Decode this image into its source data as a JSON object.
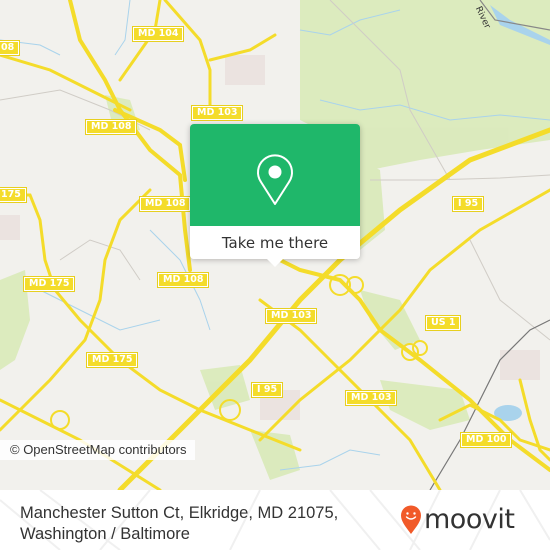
{
  "map": {
    "road_labels": [
      {
        "id": "md104",
        "text": "MD 104"
      },
      {
        "id": "md108-left-edge",
        "text": "08"
      },
      {
        "id": "md103-top",
        "text": "MD 103"
      },
      {
        "id": "md108-a",
        "text": "MD 108"
      },
      {
        "id": "md175-left-edge",
        "text": "175"
      },
      {
        "id": "md108-b",
        "text": "MD 108"
      },
      {
        "id": "md108-c",
        "text": "MD 108"
      },
      {
        "id": "md175-a",
        "text": "MD 175"
      },
      {
        "id": "md175-b",
        "text": "MD 175"
      },
      {
        "id": "i95-top",
        "text": "I 95"
      },
      {
        "id": "md103-mid",
        "text": "MD 103"
      },
      {
        "id": "us1",
        "text": "US 1"
      },
      {
        "id": "i95-bottom",
        "text": "I 95"
      },
      {
        "id": "md103-bottom",
        "text": "MD 103"
      },
      {
        "id": "md100",
        "text": "MD 100"
      }
    ],
    "water_label": "River",
    "attribution": "© OpenStreetMap contributors",
    "colors": {
      "land": "#f2f1ed",
      "park": "#d9eab8",
      "road": "#f4dc2a",
      "water": "#a9d3ec",
      "urban": "#ebe3e0"
    }
  },
  "popup": {
    "icon": "map-pin-icon",
    "button_label": "Take me there",
    "accent_color": "#1fb76a"
  },
  "footer": {
    "address_line1": "Manchester Sutton Ct, Elkridge, MD 21075,",
    "address_line2": "Washington / Baltimore",
    "logo_text": "moovit",
    "logo_color": "#f15a29"
  }
}
